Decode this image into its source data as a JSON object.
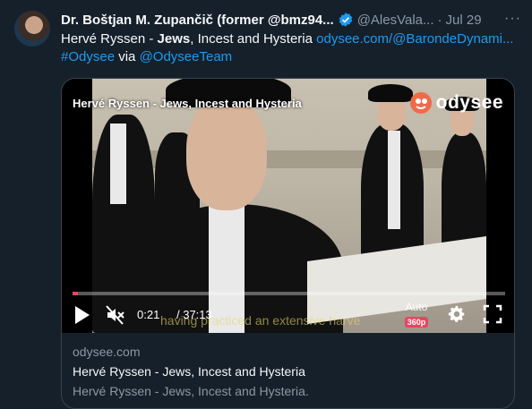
{
  "tweet": {
    "author_name": "Dr. Boštjan M. Zupančič (former @bmz94...",
    "handle": "@AlesVala...",
    "separator": "·",
    "date": "Jul 29",
    "more": "···",
    "text_part1": "Hervé Ryssen - ",
    "text_bold": "Jews",
    "text_part2": ", Incest and Hysteria ",
    "link_url": "odysee.com/@BarondeDynami...",
    "hashtag": "#Odysee",
    "via": " via ",
    "mention": "@OdyseeTeam"
  },
  "video": {
    "title": "Hervé Ryssen - Jews, Incest and Hysteria",
    "brand": "odysee",
    "current_time": "0:21",
    "total_time": "/ 37:13",
    "progress_fraction": 0.012,
    "subtitle": "having practiced an extensive harve",
    "quality_mode": "Auto",
    "quality_res": "360p"
  },
  "card": {
    "domain": "odysee.com",
    "title": "Hervé Ryssen - Jews, Incest and Hysteria",
    "description": "Hervé Ryssen - Jews, Incest and Hysteria."
  },
  "colors": {
    "background": "#15202b",
    "link": "#1d9bf0",
    "muted": "#8b98a5",
    "accent": "#e94560"
  }
}
